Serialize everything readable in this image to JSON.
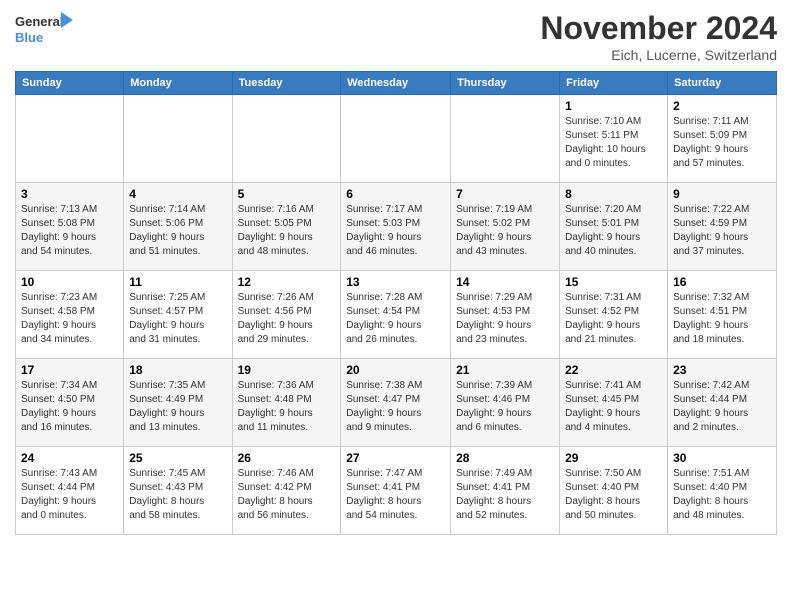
{
  "logo": {
    "line1": "General",
    "line2": "Blue"
  },
  "title": "November 2024",
  "location": "Eich, Lucerne, Switzerland",
  "headers": [
    "Sunday",
    "Monday",
    "Tuesday",
    "Wednesday",
    "Thursday",
    "Friday",
    "Saturday"
  ],
  "weeks": [
    [
      {
        "day": "",
        "info": ""
      },
      {
        "day": "",
        "info": ""
      },
      {
        "day": "",
        "info": ""
      },
      {
        "day": "",
        "info": ""
      },
      {
        "day": "",
        "info": ""
      },
      {
        "day": "1",
        "info": "Sunrise: 7:10 AM\nSunset: 5:11 PM\nDaylight: 10 hours\nand 0 minutes."
      },
      {
        "day": "2",
        "info": "Sunrise: 7:11 AM\nSunset: 5:09 PM\nDaylight: 9 hours\nand 57 minutes."
      }
    ],
    [
      {
        "day": "3",
        "info": "Sunrise: 7:13 AM\nSunset: 5:08 PM\nDaylight: 9 hours\nand 54 minutes."
      },
      {
        "day": "4",
        "info": "Sunrise: 7:14 AM\nSunset: 5:06 PM\nDaylight: 9 hours\nand 51 minutes."
      },
      {
        "day": "5",
        "info": "Sunrise: 7:16 AM\nSunset: 5:05 PM\nDaylight: 9 hours\nand 48 minutes."
      },
      {
        "day": "6",
        "info": "Sunrise: 7:17 AM\nSunset: 5:03 PM\nDaylight: 9 hours\nand 46 minutes."
      },
      {
        "day": "7",
        "info": "Sunrise: 7:19 AM\nSunset: 5:02 PM\nDaylight: 9 hours\nand 43 minutes."
      },
      {
        "day": "8",
        "info": "Sunrise: 7:20 AM\nSunset: 5:01 PM\nDaylight: 9 hours\nand 40 minutes."
      },
      {
        "day": "9",
        "info": "Sunrise: 7:22 AM\nSunset: 4:59 PM\nDaylight: 9 hours\nand 37 minutes."
      }
    ],
    [
      {
        "day": "10",
        "info": "Sunrise: 7:23 AM\nSunset: 4:58 PM\nDaylight: 9 hours\nand 34 minutes."
      },
      {
        "day": "11",
        "info": "Sunrise: 7:25 AM\nSunset: 4:57 PM\nDaylight: 9 hours\nand 31 minutes."
      },
      {
        "day": "12",
        "info": "Sunrise: 7:26 AM\nSunset: 4:56 PM\nDaylight: 9 hours\nand 29 minutes."
      },
      {
        "day": "13",
        "info": "Sunrise: 7:28 AM\nSunset: 4:54 PM\nDaylight: 9 hours\nand 26 minutes."
      },
      {
        "day": "14",
        "info": "Sunrise: 7:29 AM\nSunset: 4:53 PM\nDaylight: 9 hours\nand 23 minutes."
      },
      {
        "day": "15",
        "info": "Sunrise: 7:31 AM\nSunset: 4:52 PM\nDaylight: 9 hours\nand 21 minutes."
      },
      {
        "day": "16",
        "info": "Sunrise: 7:32 AM\nSunset: 4:51 PM\nDaylight: 9 hours\nand 18 minutes."
      }
    ],
    [
      {
        "day": "17",
        "info": "Sunrise: 7:34 AM\nSunset: 4:50 PM\nDaylight: 9 hours\nand 16 minutes."
      },
      {
        "day": "18",
        "info": "Sunrise: 7:35 AM\nSunset: 4:49 PM\nDaylight: 9 hours\nand 13 minutes."
      },
      {
        "day": "19",
        "info": "Sunrise: 7:36 AM\nSunset: 4:48 PM\nDaylight: 9 hours\nand 11 minutes."
      },
      {
        "day": "20",
        "info": "Sunrise: 7:38 AM\nSunset: 4:47 PM\nDaylight: 9 hours\nand 9 minutes."
      },
      {
        "day": "21",
        "info": "Sunrise: 7:39 AM\nSunset: 4:46 PM\nDaylight: 9 hours\nand 6 minutes."
      },
      {
        "day": "22",
        "info": "Sunrise: 7:41 AM\nSunset: 4:45 PM\nDaylight: 9 hours\nand 4 minutes."
      },
      {
        "day": "23",
        "info": "Sunrise: 7:42 AM\nSunset: 4:44 PM\nDaylight: 9 hours\nand 2 minutes."
      }
    ],
    [
      {
        "day": "24",
        "info": "Sunrise: 7:43 AM\nSunset: 4:44 PM\nDaylight: 9 hours\nand 0 minutes."
      },
      {
        "day": "25",
        "info": "Sunrise: 7:45 AM\nSunset: 4:43 PM\nDaylight: 8 hours\nand 58 minutes."
      },
      {
        "day": "26",
        "info": "Sunrise: 7:46 AM\nSunset: 4:42 PM\nDaylight: 8 hours\nand 56 minutes."
      },
      {
        "day": "27",
        "info": "Sunrise: 7:47 AM\nSunset: 4:41 PM\nDaylight: 8 hours\nand 54 minutes."
      },
      {
        "day": "28",
        "info": "Sunrise: 7:49 AM\nSunset: 4:41 PM\nDaylight: 8 hours\nand 52 minutes."
      },
      {
        "day": "29",
        "info": "Sunrise: 7:50 AM\nSunset: 4:40 PM\nDaylight: 8 hours\nand 50 minutes."
      },
      {
        "day": "30",
        "info": "Sunrise: 7:51 AM\nSunset: 4:40 PM\nDaylight: 8 hours\nand 48 minutes."
      }
    ]
  ]
}
